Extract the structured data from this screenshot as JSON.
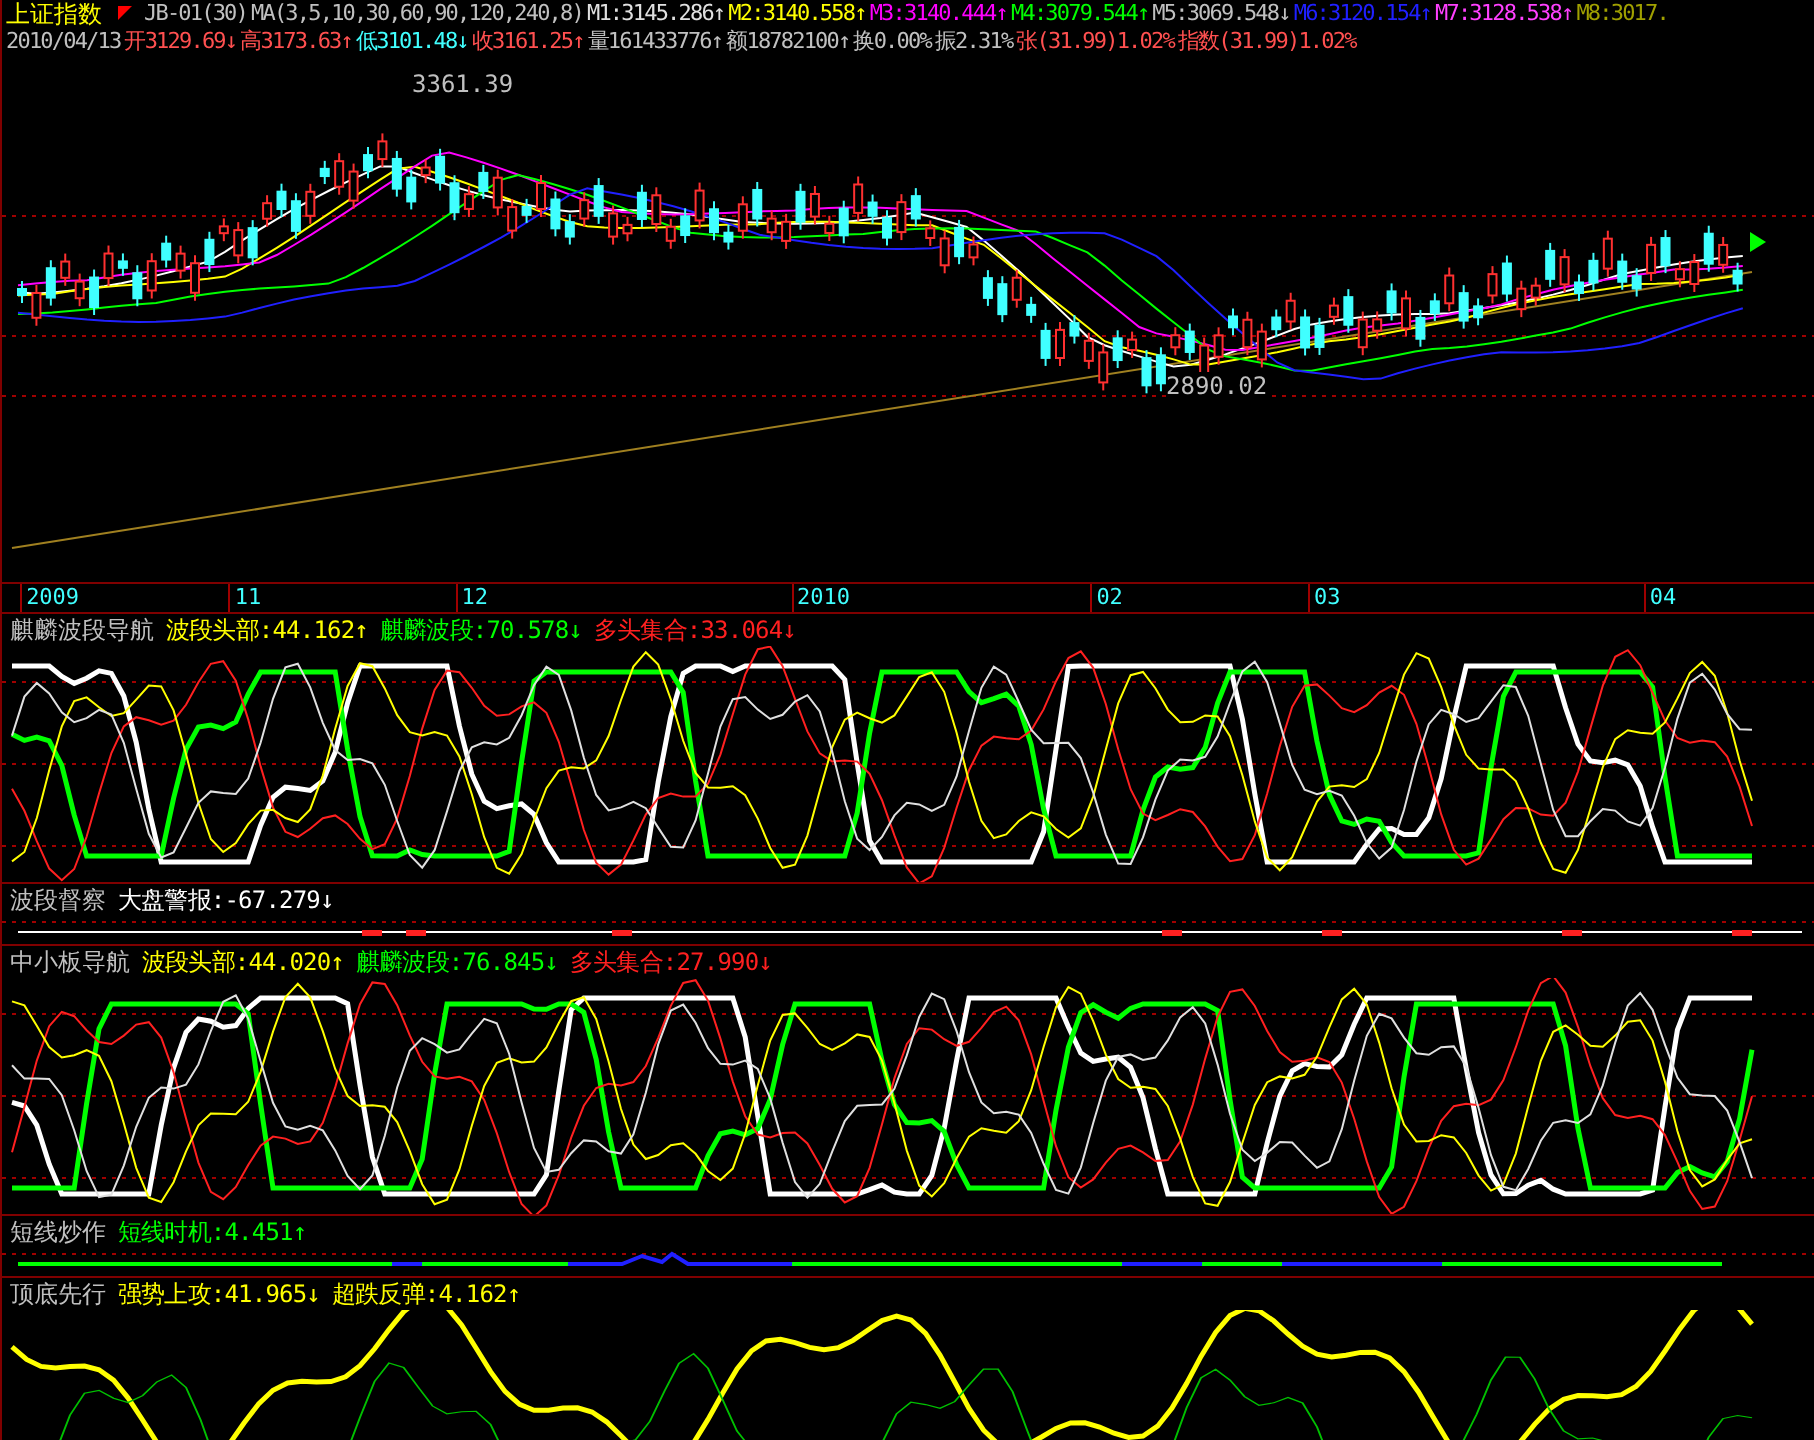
{
  "header": {
    "title": "上证指数",
    "code": "JB-01(30)",
    "ma": "MA(3,5,10,30,60,90,120,240,8)",
    "ma_values": [
      {
        "text": "M1:3145.286",
        "arrow": "↑",
        "color": "#e0e0e0"
      },
      {
        "text": "M2:3140.558",
        "arrow": "↑",
        "color": "#ffff00"
      },
      {
        "text": "M3:3140.444",
        "arrow": "↑",
        "color": "#ff00ff"
      },
      {
        "text": "M4:3079.544",
        "arrow": "↑",
        "color": "#00ff00"
      },
      {
        "text": "M5:3069.548",
        "arrow": "↓",
        "color": "#c0c0c0"
      },
      {
        "text": "M6:3120.154",
        "arrow": "↑",
        "color": "#2020ff"
      },
      {
        "text": "M7:3128.538",
        "arrow": "↑",
        "color": "#ff40ff"
      },
      {
        "text": "M8:3017.",
        "color": "#a0a000"
      }
    ]
  },
  "quote": {
    "date": "2010/04/13",
    "items": [
      {
        "text": "开3129.69",
        "arrow": "↓",
        "color": "#ff5050"
      },
      {
        "text": "高3173.63",
        "arrow": "↑",
        "color": "#ff5050"
      },
      {
        "text": "低3101.48",
        "arrow": "↓",
        "color": "#40ffff"
      },
      {
        "text": "收3161.25",
        "arrow": "↑",
        "color": "#ff5050"
      },
      {
        "text": "量161433776",
        "arrow": "↑",
        "color": "#c0c0c0"
      },
      {
        "text": "额18782100",
        "arrow": "↑",
        "color": "#c0c0c0"
      },
      {
        "text": "换0.00%",
        "color": "#c0c0c0"
      },
      {
        "text": "振2.31%",
        "color": "#c0c0c0"
      },
      {
        "text": "张(31.99)1.02%",
        "color": "#ff5050"
      },
      {
        "text": "指数(31.99)1.02%",
        "color": "#ff5050"
      }
    ]
  },
  "price_chart": {
    "high_label": "3361.39",
    "low_label": "2890.02"
  },
  "time_axis": [
    "2009",
    "11",
    "12",
    "2010",
    "02",
    "03",
    "04"
  ],
  "panels": [
    {
      "kind": "oscillator",
      "name": "麒麟波段导航",
      "values": [
        {
          "text": "波段头部:44.162",
          "arrow": "↑",
          "color": "#ffff00"
        },
        {
          "text": "麒麟波段:70.578",
          "arrow": "↓",
          "color": "#00ff00"
        },
        {
          "text": "多头集合:33.064",
          "arrow": "↓",
          "color": "#ff2020"
        }
      ]
    },
    {
      "kind": "alert",
      "name": "波段督察",
      "values": [
        {
          "text": "大盘警报:-67.279",
          "arrow": "↓",
          "color": "#ffffff"
        }
      ]
    },
    {
      "kind": "oscillator",
      "name": "中小板导航",
      "values": [
        {
          "text": "波段头部:44.020",
          "arrow": "↑",
          "color": "#ffff00"
        },
        {
          "text": "麒麟波段:76.845",
          "arrow": "↓",
          "color": "#00ff00"
        },
        {
          "text": "多头集合:27.990",
          "arrow": "↓",
          "color": "#ff2020"
        }
      ]
    },
    {
      "kind": "signal",
      "name": "短线炒作",
      "values": [
        {
          "text": "短线时机:4.451",
          "arrow": "↑",
          "color": "#00ff00"
        }
      ]
    },
    {
      "kind": "dual",
      "name": "顶底先行",
      "values": [
        {
          "text": "强势上攻:41.965",
          "arrow": "↓",
          "color": "#ffff00"
        },
        {
          "text": "超跌反弹:4.162",
          "arrow": "↑",
          "color": "#ffff00"
        }
      ]
    }
  ]
}
